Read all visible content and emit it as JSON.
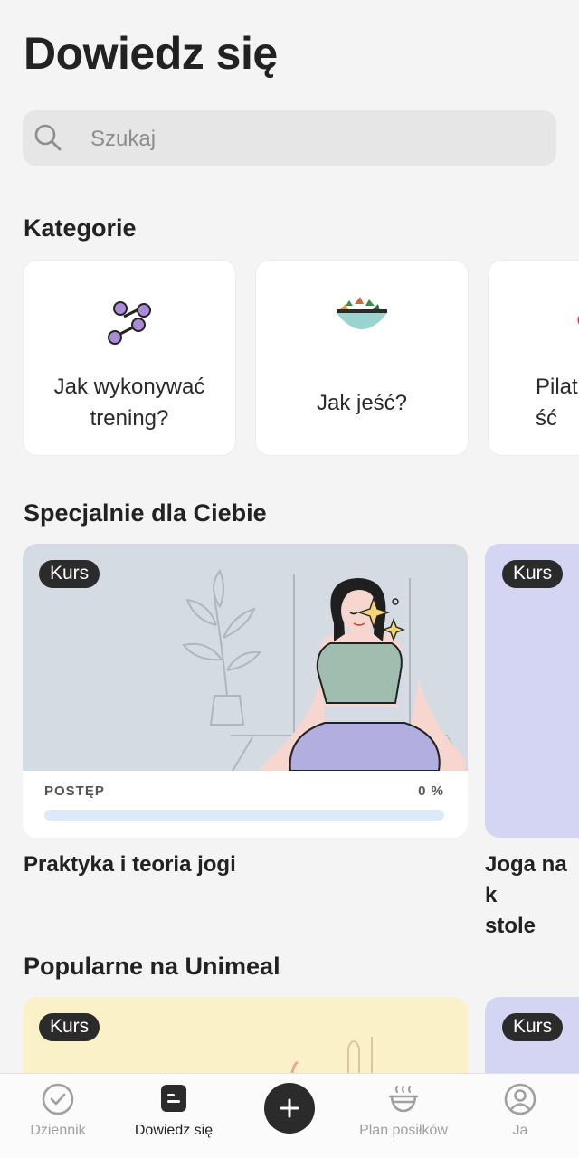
{
  "header": {
    "title": "Dowiedz się"
  },
  "search": {
    "placeholder": "Szukaj"
  },
  "categories": {
    "title": "Kategorie",
    "items": [
      {
        "label": "Jak wykonywać trening?",
        "icon": "dumbbell-icon"
      },
      {
        "label": "Jak jeść?",
        "icon": "salad-bowl-icon"
      },
      {
        "label": "Pilates ść",
        "icon": "pilates-icon"
      }
    ]
  },
  "for_you": {
    "title": "Specjalnie dla Ciebie",
    "cards": [
      {
        "badge": "Kurs",
        "progress_label": "POSTĘP",
        "progress_value": "0 %",
        "progress": 0,
        "title": "Praktyka i teoria jogi"
      },
      {
        "badge": "Kurs",
        "title": "Joga na k stole"
      }
    ]
  },
  "popular": {
    "title": "Popularne na Unimeal",
    "cards": [
      {
        "badge": "Kurs"
      },
      {
        "badge": "Kurs"
      }
    ]
  },
  "tabbar": {
    "items": [
      {
        "label": "Dziennik",
        "icon": "check-circle-icon"
      },
      {
        "label": "Dowiedz się",
        "icon": "learn-icon",
        "active": true
      },
      {
        "label": "",
        "icon": "plus-icon"
      },
      {
        "label": "Plan posiłków",
        "icon": "meal-bowl-icon"
      },
      {
        "label": "Ja",
        "icon": "profile-icon"
      }
    ]
  },
  "colors": {
    "background": "#f4f4f4",
    "yoga_art_bg": "#d5dbe3",
    "lavender_card": "#d3d5f3",
    "yellow_card": "#fbf1c8",
    "badge_bg": "#2b2b2b",
    "progress_track": "#dce9f8"
  }
}
